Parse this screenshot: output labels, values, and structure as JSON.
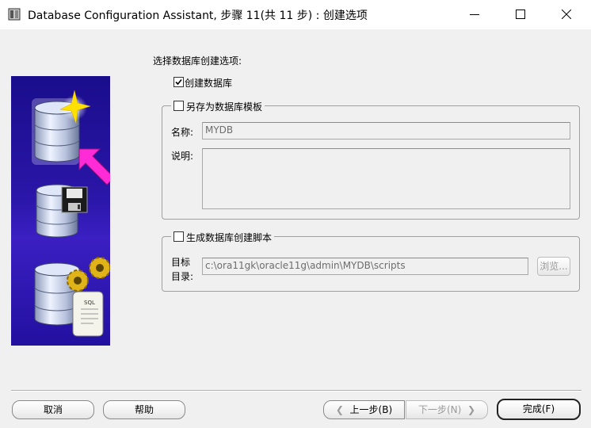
{
  "window": {
    "title": "Database Configuration Assistant, 步骤 11(共 11 步) : 创建选项"
  },
  "main": {
    "section_label": "选择数据库创建选项:",
    "create_db": {
      "label": "创建数据库",
      "checked": true
    },
    "save_template": {
      "label": "另存为数据库模板",
      "checked": false,
      "name_label": "名称:",
      "name_value": "MYDB",
      "desc_label": "说明:",
      "desc_value": ""
    },
    "gen_scripts": {
      "label": "生成数据库创建脚本",
      "checked": false,
      "dir_label_line1": "目标",
      "dir_label_line2": "目录:",
      "dir_value": "c:\\ora11gk\\oracle11g\\admin\\MYDB\\scripts",
      "browse_label": "浏览..."
    }
  },
  "footer": {
    "cancel_label": "取消",
    "help_label": "帮助",
    "back_label": "上一步(B)",
    "next_label": "下一步(N)",
    "finish_label": "完成(F)"
  },
  "colors": {
    "side_panel": "#2a16a8",
    "arrow": "#ff2bd6",
    "star": "#ffe000"
  }
}
